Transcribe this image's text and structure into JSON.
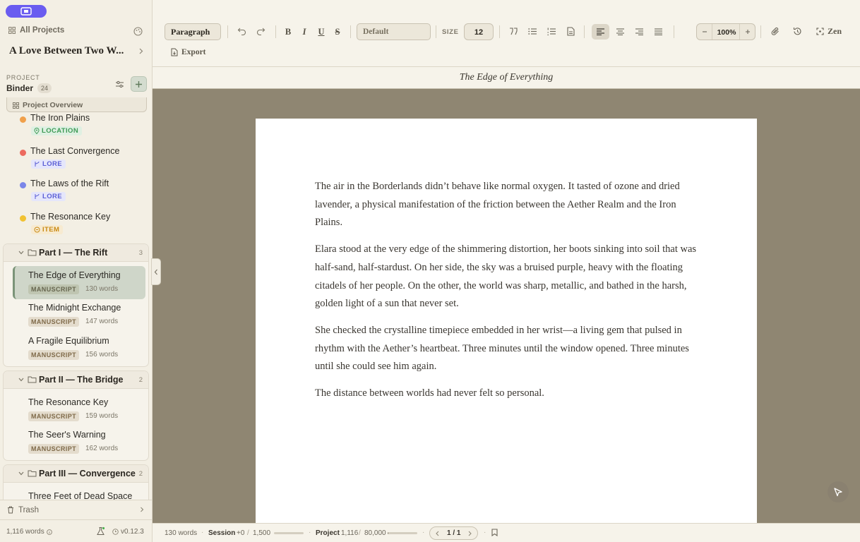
{
  "sidebar": {
    "all_projects": "All Projects",
    "project_title": "A Love Between Two W...",
    "section_label": "PROJECT",
    "binder_label": "Binder",
    "binder_count": "24",
    "overview_label": "Project Overview",
    "entities": [
      {
        "name": "The Iron Plains",
        "tag": "LOCATION",
        "color": "#f0a04b"
      },
      {
        "name": "The Last Convergence",
        "tag": "LORE",
        "color": "#ec6a5e"
      },
      {
        "name": "The Laws of the Rift",
        "tag": "LORE",
        "color": "#7b86e8"
      },
      {
        "name": "The Resonance Key",
        "tag": "ITEM",
        "color": "#f1c232"
      }
    ],
    "parts": [
      {
        "title": "Part I — The Rift",
        "count": "3",
        "docs": [
          {
            "name": "The Edge of Everything",
            "tag": "MANUSCRIPT",
            "words": "130 words"
          },
          {
            "name": "The Midnight Exchange",
            "tag": "MANUSCRIPT",
            "words": "147 words"
          },
          {
            "name": "A Fragile Equilibrium",
            "tag": "MANUSCRIPT",
            "words": "156 words"
          }
        ]
      },
      {
        "title": "Part II — The Bridge",
        "count": "2",
        "docs": [
          {
            "name": "The Resonance Key",
            "tag": "MANUSCRIPT",
            "words": "159 words"
          },
          {
            "name": "The Seer's Warning",
            "tag": "MANUSCRIPT",
            "words": "162 words"
          }
        ]
      },
      {
        "title": "Part III — Convergence",
        "count": "2",
        "docs": [
          {
            "name": "Three Feet of Dead Space"
          }
        ]
      }
    ],
    "trash_label": "Trash",
    "total_words": "1,116 words",
    "version": "v0.12.3"
  },
  "toolbar": {
    "paragraph_style": "Paragraph",
    "bold": "B",
    "italic": "I",
    "underline": "U",
    "strike": "S",
    "font": "Default",
    "size_label": "SIZE",
    "size_value": "12",
    "zoom": "100%",
    "zen_label": "Zen",
    "export_label": "Export"
  },
  "document": {
    "title": "The Edge of Everything",
    "paragraphs": [
      "The air in the Borderlands didn’t behave like normal oxygen. It tasted of ozone and dried lavender, a physical manifestation of the friction between the Aether Realm and the Iron Plains.",
      "Elara stood at the very edge of the shimmering distortion, her boots sinking into soil that was half-sand, half-stardust. On her side, the sky was a bruised purple, heavy with the floating citadels of her people. On the other, the world was sharp, metallic, and bathed in the harsh, golden light of a sun that never set.",
      "She checked the crystalline timepiece embedded in her wrist—a living gem that pulsed in rhythm with the Aether’s heartbeat. Three minutes until the window opened. Three minutes until she could see him again.",
      "The distance between worlds had never felt so personal."
    ]
  },
  "status": {
    "doc_words": "130 words",
    "session_label": "Session",
    "session_delta": "+0",
    "session_goal": "1,500",
    "session_progress": 0.0,
    "project_label": "Project",
    "project_words": "1,116",
    "project_goal": "80,000",
    "project_progress": 0.014,
    "page_indicator": "1 / 1",
    "slash": "/"
  },
  "colors": {
    "accent": "#6a5cf0",
    "canvas": "#8f8672",
    "sidebar_bg": "#f3efe4",
    "active_doc": "#cfd6c9"
  }
}
